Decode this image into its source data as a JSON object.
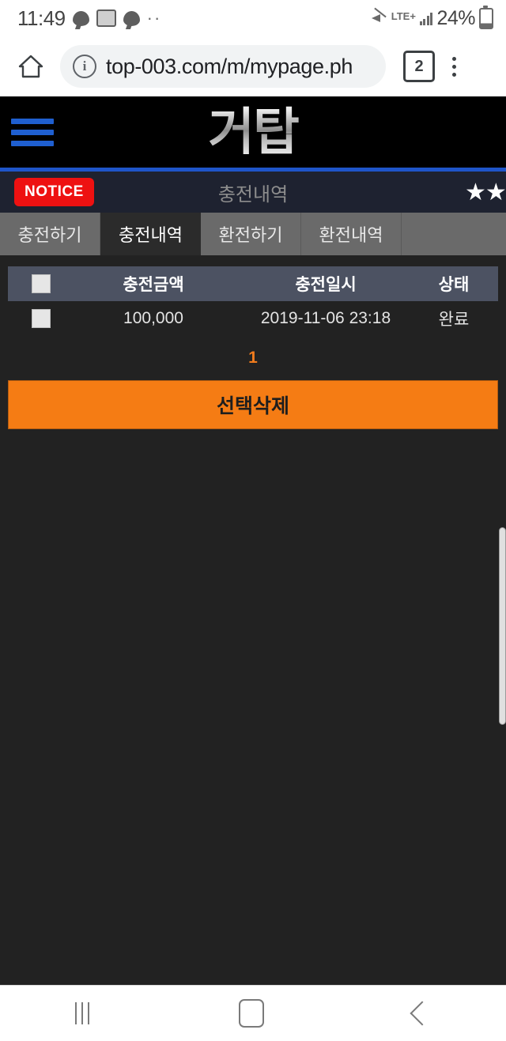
{
  "statusbar": {
    "clock": "11:49",
    "battery_percent": "24%",
    "network": "LTE+",
    "icons": [
      "kakaotalk-icon",
      "photo-icon",
      "kakaotalk-icon",
      "overflow-dots-icon",
      "mute-icon",
      "lte-icon",
      "signal-bars-icon",
      "battery-icon"
    ]
  },
  "browser": {
    "home_icon": "home-icon",
    "info_icon": "site-info-icon",
    "url": "top-003.com/m/mypage.ph",
    "tab_count": "2",
    "menu_icon": "kebab-menu-icon"
  },
  "site": {
    "menu_icon": "hamburger-menu-icon",
    "logo": "거탑",
    "accent_blue": "#1f55c9"
  },
  "notice": {
    "badge": "NOTICE",
    "title": "충전내역",
    "stars": "★★★",
    "badge_color": "#ee1111"
  },
  "tabs": [
    {
      "label": "충전하기",
      "active": false
    },
    {
      "label": "충전내역",
      "active": true
    },
    {
      "label": "환전하기",
      "active": false
    },
    {
      "label": "환전내역",
      "active": false
    }
  ],
  "table": {
    "headers": {
      "amount": "충전금액",
      "date": "충전일시",
      "state": "상태"
    },
    "rows": [
      {
        "amount": "100,000",
        "date": "2019-11-06 23:18",
        "state": "완료"
      }
    ]
  },
  "pagination": {
    "current": "1",
    "color": "#f07b1d"
  },
  "actions": {
    "delete_selected": "선택삭제",
    "delete_color": "#f57c14"
  },
  "navbar": {
    "recents": "recents-icon",
    "home": "home-icon",
    "back": "back-icon"
  }
}
